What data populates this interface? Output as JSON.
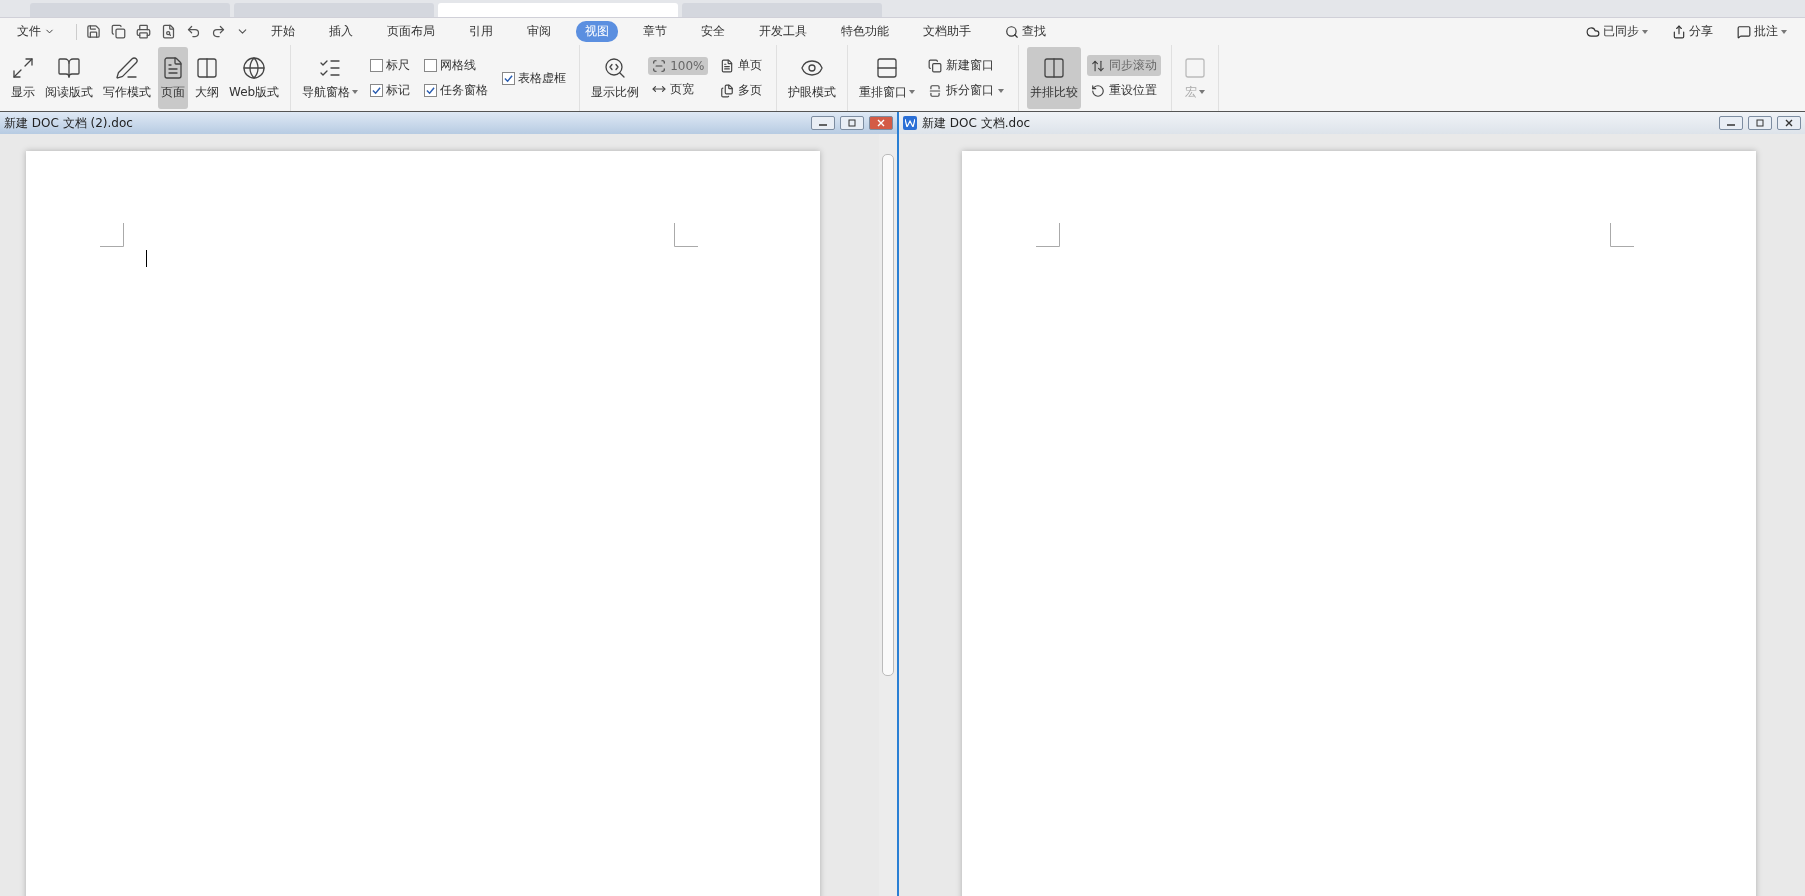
{
  "browser_tabs": [
    {
      "selected": false
    },
    {
      "selected": false
    },
    {
      "selected": true
    },
    {
      "selected": false
    }
  ],
  "menu": {
    "file": "文件",
    "tabs": [
      {
        "label": "开始",
        "selected": false
      },
      {
        "label": "插入",
        "selected": false
      },
      {
        "label": "页面布局",
        "selected": false
      },
      {
        "label": "引用",
        "selected": false
      },
      {
        "label": "审阅",
        "selected": false
      },
      {
        "label": "视图",
        "selected": true
      },
      {
        "label": "章节",
        "selected": false
      },
      {
        "label": "安全",
        "selected": false
      },
      {
        "label": "开发工具",
        "selected": false
      },
      {
        "label": "特色功能",
        "selected": false
      },
      {
        "label": "文档助手",
        "selected": false
      }
    ],
    "search": "查找",
    "right": [
      {
        "label": "已同步",
        "dropdown": true
      },
      {
        "label": "分享",
        "dropdown": false
      },
      {
        "label": "批注",
        "dropdown": true
      }
    ]
  },
  "ribbon": [
    {
      "columns": [
        {
          "kind": "large",
          "label": "显示",
          "selected": false,
          "dropdown": false,
          "disabled": false
        },
        {
          "kind": "large",
          "label": "阅读版式",
          "selected": false,
          "dropdown": false,
          "disabled": false
        },
        {
          "kind": "large",
          "label": "写作模式",
          "selected": false,
          "dropdown": false,
          "disabled": false
        },
        {
          "kind": "large",
          "label": "页面",
          "selected": true,
          "dropdown": false,
          "disabled": false
        },
        {
          "kind": "large",
          "label": "大纲",
          "selected": false,
          "dropdown": false,
          "disabled": false
        },
        {
          "kind": "large",
          "label": "Web版式",
          "selected": false,
          "dropdown": false,
          "disabled": false
        }
      ]
    },
    {
      "columns": [
        {
          "kind": "large",
          "label": "导航窗格",
          "selected": false,
          "dropdown": true,
          "disabled": false
        },
        {
          "kind": "stack",
          "items": [
            {
              "kind": "check",
              "label": "标尺",
              "checked": false
            },
            {
              "kind": "check",
              "label": "标记",
              "checked": true
            }
          ]
        },
        {
          "kind": "stack",
          "items": [
            {
              "kind": "check",
              "label": "网格线",
              "checked": false
            },
            {
              "kind": "check",
              "label": "任务窗格",
              "checked": true
            }
          ]
        },
        {
          "kind": "stack",
          "items": [
            {
              "kind": "check",
              "label": "表格虚框",
              "checked": true
            }
          ]
        }
      ]
    },
    {
      "columns": [
        {
          "kind": "large",
          "label": "显示比例",
          "selected": false,
          "dropdown": false,
          "disabled": false
        },
        {
          "kind": "stack",
          "items": [
            {
              "kind": "small",
              "label": "100%",
              "selected": true,
              "dropdown": false
            },
            {
              "kind": "small",
              "label": "页宽",
              "selected": false,
              "dropdown": false
            }
          ]
        },
        {
          "kind": "stack",
          "items": [
            {
              "kind": "small",
              "label": "单页",
              "selected": false,
              "dropdown": false
            },
            {
              "kind": "small",
              "label": "多页",
              "selected": false,
              "dropdown": false
            }
          ]
        }
      ]
    },
    {
      "columns": [
        {
          "kind": "large",
          "label": "护眼模式",
          "selected": false,
          "dropdown": false,
          "disabled": false
        }
      ]
    },
    {
      "columns": [
        {
          "kind": "large",
          "label": "重排窗口",
          "selected": false,
          "dropdown": true,
          "disabled": false
        },
        {
          "kind": "stack",
          "items": [
            {
              "kind": "small",
              "label": "新建窗口",
              "selected": false,
              "dropdown": false
            },
            {
              "kind": "small",
              "label": "拆分窗口",
              "selected": false,
              "dropdown": true
            }
          ]
        }
      ]
    },
    {
      "columns": [
        {
          "kind": "large",
          "label": "并排比较",
          "selected": true,
          "dropdown": false,
          "disabled": false
        },
        {
          "kind": "stack",
          "items": [
            {
              "kind": "small",
              "label": "同步滚动",
              "selected": true,
              "dropdown": false
            },
            {
              "kind": "small",
              "label": "重设位置",
              "selected": false,
              "dropdown": false
            }
          ]
        }
      ]
    },
    {
      "columns": [
        {
          "kind": "large",
          "label": "宏",
          "selected": false,
          "dropdown": true,
          "disabled": true
        }
      ]
    }
  ],
  "documents": [
    {
      "title": "新建 DOC 文档 (2).doc",
      "active": true,
      "cursor": true
    },
    {
      "title": "新建 DOC 文档.doc",
      "active": false,
      "cursor": false
    }
  ]
}
